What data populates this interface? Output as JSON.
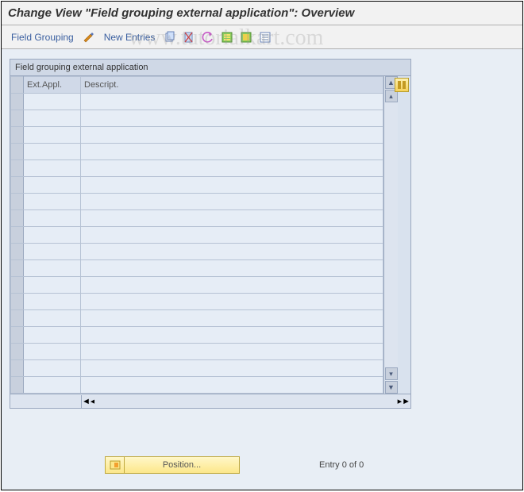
{
  "title": "Change View \"Field grouping external application\": Overview",
  "toolbar": {
    "field_grouping": "Field Grouping",
    "new_entries": "New Entries"
  },
  "grid": {
    "caption": "Field grouping external application",
    "columns": {
      "ext": "Ext.Appl.",
      "desc": "Descript."
    },
    "row_count": 18
  },
  "footer": {
    "position_label": "Position...",
    "entry_label": "Entry 0 of 0"
  },
  "watermark": "www.tutorialkart.com"
}
